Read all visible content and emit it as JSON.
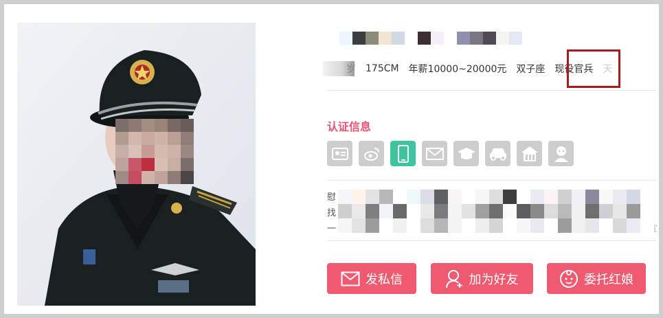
{
  "profile": {
    "info_items": [
      "岁",
      "175CM",
      "年薪10000~20000元",
      "双子座",
      "现役官兵",
      "天"
    ]
  },
  "certification": {
    "title": "认证信息",
    "icons": [
      {
        "name": "id-card-icon",
        "verified": false
      },
      {
        "name": "weibo-icon",
        "verified": false
      },
      {
        "name": "phone-icon",
        "verified": true
      },
      {
        "name": "email-icon",
        "verified": false
      },
      {
        "name": "education-icon",
        "verified": false
      },
      {
        "name": "car-icon",
        "verified": false
      },
      {
        "name": "house-icon",
        "verified": false
      },
      {
        "name": "avatar-verify-icon",
        "verified": false
      }
    ]
  },
  "bio": {
    "line_starts": [
      "慰",
      "找",
      "一"
    ],
    "line_end": "宜"
  },
  "actions": {
    "message_label": "发私信",
    "add_friend_label": "加为好友",
    "matchmaker_label": "委托红娘"
  },
  "colors": {
    "accent": "#e85572",
    "button": "#ef5a70",
    "verified": "#3fc4a0",
    "unverified": "#cdcdcd",
    "highlight_box": "#a61c1c"
  }
}
